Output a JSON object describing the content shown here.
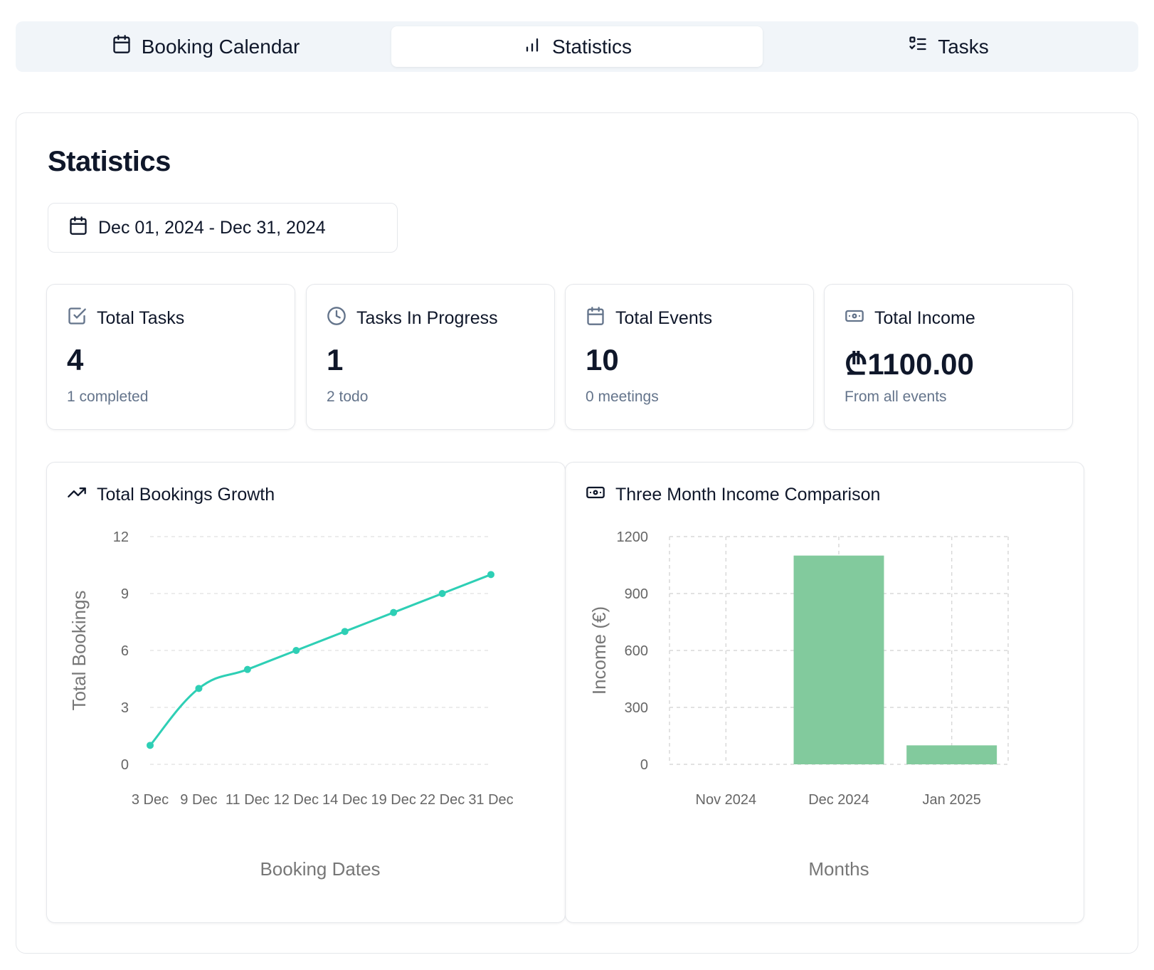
{
  "tabs": [
    {
      "label": "Booking Calendar",
      "icon": "calendar-icon",
      "active": false
    },
    {
      "label": "Statistics",
      "icon": "bar-chart-icon",
      "active": true
    },
    {
      "label": "Tasks",
      "icon": "list-checks-icon",
      "active": false
    }
  ],
  "page": {
    "title": "Statistics",
    "date_range": "Dec 01, 2024 - Dec 31, 2024"
  },
  "stats": [
    {
      "title": "Total Tasks",
      "value": "4",
      "sub": "1 completed",
      "icon": "check-square-icon"
    },
    {
      "title": "Tasks In Progress",
      "value": "1",
      "sub": "2 todo",
      "icon": "clock-icon"
    },
    {
      "title": "Total Events",
      "value": "10",
      "sub": "0 meetings",
      "icon": "calendar-icon"
    },
    {
      "title": "Total Income",
      "value": "₾1100.00",
      "sub": "From all events",
      "icon": "banknote-icon"
    }
  ],
  "charts": {
    "growth": {
      "title": "Total Bookings Growth",
      "icon": "trending-up-icon"
    },
    "income": {
      "title": "Three Month Income Comparison",
      "icon": "banknote-icon"
    }
  },
  "colors": {
    "line": "#2ecfb5",
    "bar": "#82ca9d",
    "grid": "#d9d9d9"
  },
  "chart_data": [
    {
      "type": "line",
      "x": [
        "3 Dec",
        "9 Dec",
        "11 Dec",
        "12 Dec",
        "14 Dec",
        "19 Dec",
        "22 Dec",
        "31 Dec"
      ],
      "y": [
        1,
        4,
        5,
        6,
        7,
        8,
        9,
        10
      ],
      "xlabel": "Booking Dates",
      "ylabel": "Total Bookings",
      "yticks": [
        0,
        3,
        6,
        9,
        12
      ],
      "ylim": [
        0,
        12
      ],
      "grid": "horizontal dashed"
    },
    {
      "type": "bar",
      "categories": [
        "Nov 2024",
        "Dec 2024",
        "Jan 2025"
      ],
      "values": [
        0,
        1100,
        100
      ],
      "xlabel": "Months",
      "ylabel": "Income (€)",
      "yticks": [
        0,
        300,
        600,
        900,
        1200
      ],
      "ylim": [
        0,
        1200
      ],
      "grid": "dashed both"
    }
  ]
}
